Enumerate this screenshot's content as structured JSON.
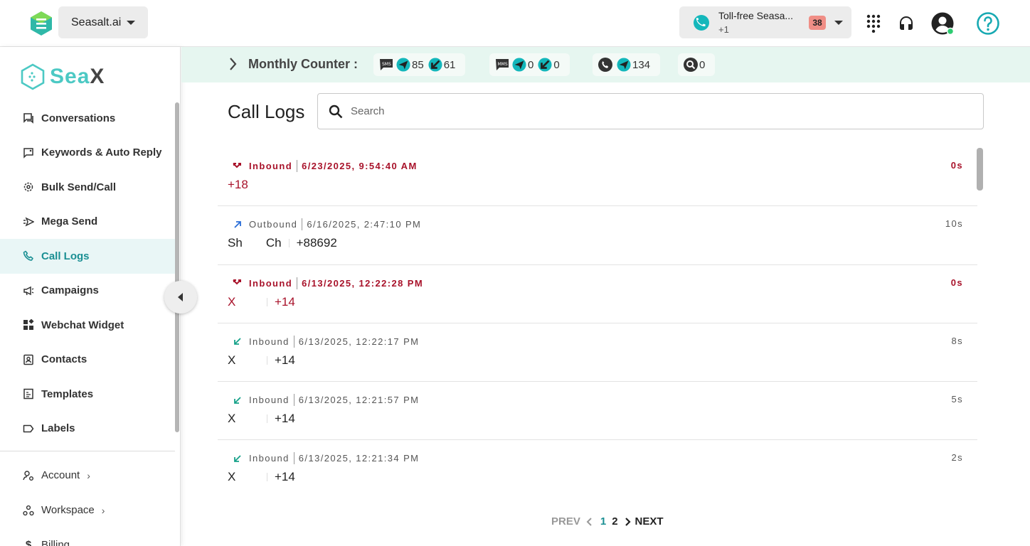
{
  "topbar": {
    "org_name": "Seasalt.ai",
    "phone_line1": "Toll-free Seasa...",
    "phone_line2": "+1",
    "unread_badge": "38",
    "icons": [
      "dialpad-icon",
      "headset-icon",
      "account-icon",
      "help-icon"
    ],
    "status_color": "#2ecc71"
  },
  "brand": {
    "text_a": "Sea",
    "text_b": "X",
    "accent": "#4cc9c4"
  },
  "sidebar": {
    "items": [
      {
        "label": "Conversations",
        "icon": "chat-icon"
      },
      {
        "label": "Keywords & Auto Reply",
        "icon": "auto-reply-icon"
      },
      {
        "label": "Bulk Send/Call",
        "icon": "bulk-send-icon"
      },
      {
        "label": "Mega Send",
        "icon": "mega-send-icon"
      },
      {
        "label": "Call Logs",
        "icon": "phone-icon",
        "active": true
      },
      {
        "label": "Campaigns",
        "icon": "megaphone-icon"
      },
      {
        "label": "Webchat Widget",
        "icon": "widget-icon"
      },
      {
        "label": "Contacts",
        "icon": "contacts-icon"
      },
      {
        "label": "Templates",
        "icon": "templates-icon"
      },
      {
        "label": "Labels",
        "icon": "label-icon"
      }
    ],
    "bottom": [
      {
        "label": "Account",
        "icon": "account-settings-icon"
      },
      {
        "label": "Workspace",
        "icon": "workspace-icon"
      },
      {
        "label": "Billing",
        "icon": "billing-icon"
      }
    ]
  },
  "counter": {
    "title": "Monthly Counter :",
    "sms_sent": "85",
    "sms_received": "61",
    "mms_sent": "0",
    "mms_received": "0",
    "call_count": "134",
    "search_count": "0"
  },
  "main": {
    "title": "Call Logs",
    "search_placeholder": "Search"
  },
  "logs": [
    {
      "direction": "Inbound",
      "time": "6/23/2025, 9:54:40 AM",
      "duration": "0s",
      "name": "",
      "number": "+18",
      "missed": true
    },
    {
      "direction": "Outbound",
      "time": "6/16/2025, 2:47:10 PM",
      "duration": "10s",
      "name": "Sh       Ch",
      "number": "+88692",
      "missed": false
    },
    {
      "direction": "Inbound",
      "time": "6/13/2025, 12:22:28 PM",
      "duration": "0s",
      "name": "X",
      "number": "+14",
      "missed": true
    },
    {
      "direction": "Inbound",
      "time": "6/13/2025, 12:22:17 PM",
      "duration": "8s",
      "name": "X",
      "number": "+14",
      "missed": false
    },
    {
      "direction": "Inbound",
      "time": "6/13/2025, 12:21:57 PM",
      "duration": "5s",
      "name": "X",
      "number": "+14",
      "missed": false
    },
    {
      "direction": "Inbound",
      "time": "6/13/2025, 12:21:34 PM",
      "duration": "2s",
      "name": "X",
      "number": "+14",
      "missed": false
    }
  ],
  "pager": {
    "prev": "PREV",
    "page1": "1",
    "page2": "2",
    "next": "NEXT"
  },
  "colors": {
    "teal": "#1a8f93",
    "missed": "#a8122a",
    "counter_bg": "#e6f6f0"
  }
}
